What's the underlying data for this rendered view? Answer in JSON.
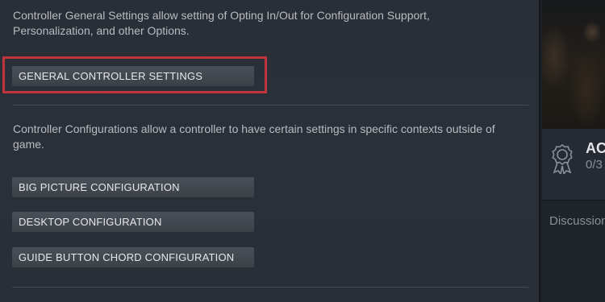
{
  "general_section": {
    "description": "Controller General Settings allow setting of Opting In/Out for Configuration Support, Personalization, and other Options.",
    "button_label": "GENERAL CONTROLLER SETTINGS"
  },
  "config_section": {
    "description": "Controller Configurations allow a controller to have certain settings in specific contexts outside of game.",
    "buttons": [
      {
        "label": "BIG PICTURE CONFIGURATION"
      },
      {
        "label": "DESKTOP CONFIGURATION"
      },
      {
        "label": "GUIDE BUTTON CHORD CONFIGURATION"
      }
    ]
  },
  "sidebar": {
    "achievements": {
      "icon": "achievement-medal-icon",
      "title": "AC",
      "count": "0/3"
    },
    "discussions_label": "Discussion"
  },
  "colors": {
    "highlight": "#c0343c",
    "panel_bg": "#2a2f37",
    "button_bg": "#4a5058"
  }
}
